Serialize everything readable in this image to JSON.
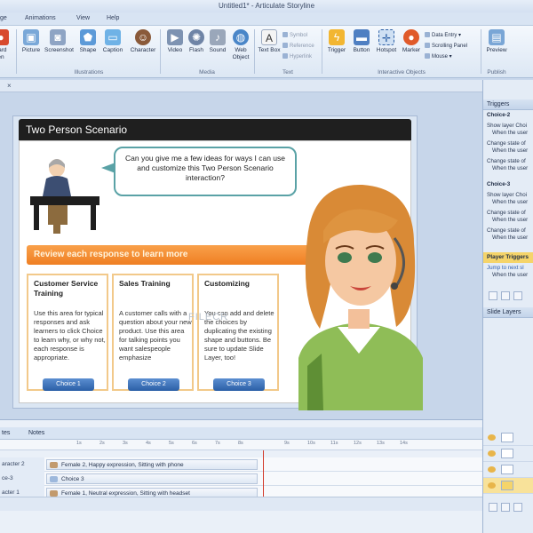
{
  "window": {
    "title": "Untitled1* - Articulate Storyline"
  },
  "menu_tabs": [
    "ge",
    "Animations",
    "View",
    "Help"
  ],
  "ribbon": {
    "buttons": [
      {
        "label": "Picture",
        "icon": "picture-icon"
      },
      {
        "label": "Screenshot",
        "icon": "camera-icon"
      },
      {
        "label": "Shape",
        "icon": "shape-icon"
      },
      {
        "label": "Caption",
        "icon": "caption-icon"
      },
      {
        "label": "Character",
        "icon": "character-icon"
      },
      {
        "label": "Video",
        "icon": "video-icon"
      },
      {
        "label": "Flash",
        "icon": "flash-icon"
      },
      {
        "label": "Sound",
        "icon": "sound-icon"
      },
      {
        "label": "Web Object",
        "icon": "globe-icon"
      },
      {
        "label": "Text Box",
        "icon": "textbox-icon"
      },
      {
        "label": "Trigger",
        "icon": "lightning-icon"
      },
      {
        "label": "Button",
        "icon": "button-icon"
      },
      {
        "label": "Hotspot",
        "icon": "hotspot-icon"
      },
      {
        "label": "Marker",
        "icon": "marker-icon"
      },
      {
        "label": "Preview",
        "icon": "preview-icon"
      }
    ],
    "small_items": {
      "symbol": "Symbol",
      "reference": "Reference",
      "hyperlink": "Hyperlink",
      "data_entry": "Data Entry",
      "scrolling_panel": "Scrolling Panel",
      "mouse": "Mouse"
    },
    "groups": {
      "illustrations": "Illustrations",
      "media": "Media",
      "text": "Text",
      "interactive": "Interactive Objects",
      "publish": "Publish"
    },
    "left_cut": [
      "oard",
      "en"
    ]
  },
  "slide": {
    "title": "Two Person Scenario",
    "bubble": "Can you give me a few ideas for ways I can use and customize this Two Person Scenario interaction?",
    "banner": "Review each response to learn more",
    "watermark": "FILECR",
    "cards": [
      {
        "title": "Customer Service Training",
        "body": "Use this area for typical responses and ask learners to click Choice to learn why, or why not, each response is appropriate.",
        "button": "Choice 1"
      },
      {
        "title": "Sales Training",
        "body": "A customer calls with a question about your new product. Use this area for talking points you want salespeople emphasize",
        "button": "Choice 2"
      },
      {
        "title": "Customizing",
        "body": "You can add and delete the choices by duplicating the existing shape and buttons. Be sure to update Slide Layer, too!",
        "button": "Choice 3"
      }
    ]
  },
  "triggers_panel": {
    "header": "Triggers",
    "items": [
      {
        "text": "Choice-2",
        "style": "b"
      },
      {
        "text": "Show layer Choi",
        "style": ""
      },
      {
        "text": "When the user",
        "style": ""
      },
      {
        "text": "Change state of",
        "style": ""
      },
      {
        "text": "When the user",
        "style": ""
      },
      {
        "text": "Change state of",
        "style": ""
      },
      {
        "text": "When the user",
        "style": ""
      },
      {
        "text": "Choice-3",
        "style": "b"
      },
      {
        "text": "Show layer Choi",
        "style": ""
      },
      {
        "text": "When the user",
        "style": ""
      },
      {
        "text": "Change state of",
        "style": ""
      },
      {
        "text": "When the user",
        "style": ""
      },
      {
        "text": "Change state of",
        "style": ""
      },
      {
        "text": "When the user",
        "style": ""
      }
    ],
    "player_triggers": "Player Triggers",
    "jump_to": "Jump to next sl",
    "jump_when": "When the user",
    "slide_layers": "Slide Layers"
  },
  "timeline": {
    "tabs": [
      {
        "label": "tes",
        "active": false
      },
      {
        "label": "Notes",
        "active": false
      }
    ],
    "ticks": [
      "1s",
      "2s",
      "3s",
      "4s",
      "5s",
      "6s",
      "7s",
      "8s",
      "9s",
      "10s",
      "11s",
      "12s",
      "13s",
      "14s"
    ],
    "rows": [
      {
        "name": "aracter 2",
        "bar": "Female 2, Happy expression, Sitting with phone"
      },
      {
        "name": "ce-3",
        "bar": "Choice 3"
      },
      {
        "name": "acter 1",
        "bar": "Female 1, Neutral expression, Sitting with headset"
      }
    ]
  },
  "colors": {
    "accent_orange": "#ef7f23",
    "card_border": "#f2c98a",
    "bubble_border": "#5aa2a6",
    "button_blue": "#2b5fa6",
    "player_triggers_bg": "#f5d46a"
  }
}
